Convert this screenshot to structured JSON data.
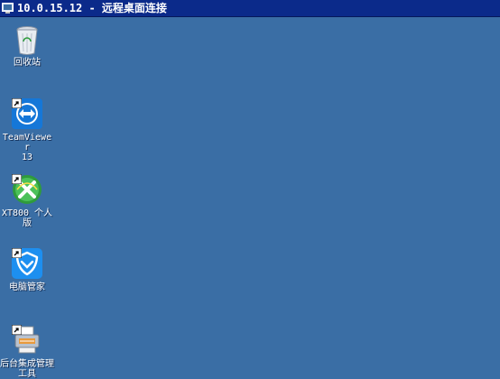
{
  "window": {
    "title": "10.0.15.12 - 远程桌面连接"
  },
  "desktop": {
    "background_color": "#3a6ea5",
    "icons": [
      {
        "label": "回收站",
        "icon": "recycle-bin-icon",
        "shortcut": false
      },
      {
        "label_line1": "TeamViewer",
        "label_line2": "13",
        "icon": "teamviewer-icon",
        "shortcut": true
      },
      {
        "label": "XT800 个人版",
        "icon": "xt800-icon",
        "shortcut": true
      },
      {
        "label": "电脑管家",
        "icon": "pc-manager-icon",
        "shortcut": true
      },
      {
        "label_line1": "后台集成管理",
        "label_line2": "工具",
        "icon": "integration-tool-icon",
        "shortcut": true
      }
    ]
  }
}
